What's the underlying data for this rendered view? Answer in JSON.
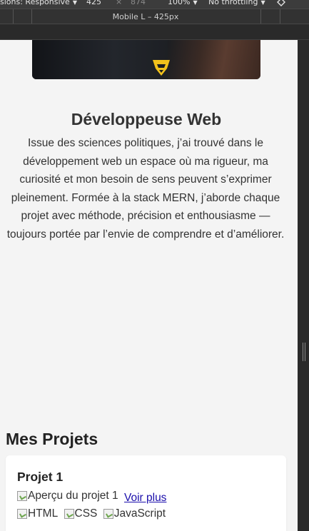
{
  "devtools": {
    "dimensions_label": "sions: Responsive",
    "width": "425",
    "times": "×",
    "height": "874",
    "zoom": "100%",
    "throttling": "No throttling",
    "device_label": "Mobile L – 425px"
  },
  "about": {
    "title": "Développeuse Web",
    "bio": "Issue des sciences politiques, j’ai trouvé dans le développement web un espace où ma rigueur, ma curiosité et mon besoin de sens peuvent s’exprimer pleinement. Formée à la stack MERN, j’aborde chaque projet avec méthode, précision et enthousiasme — toujours portée par l’envie de comprendre et d’améliorer."
  },
  "projects": {
    "section_title": "Mes Projets",
    "items": [
      {
        "title": "Projet 1",
        "image_alt": "Aperçu du projet 1",
        "link": "Voir plus",
        "tech": [
          "HTML",
          "CSS",
          "JavaScript"
        ]
      }
    ]
  },
  "colors": {
    "page_bg": "#f4f4f4",
    "text": "#333333",
    "link": "#1a0dab",
    "devtools_bg": "#3c3c3c"
  }
}
